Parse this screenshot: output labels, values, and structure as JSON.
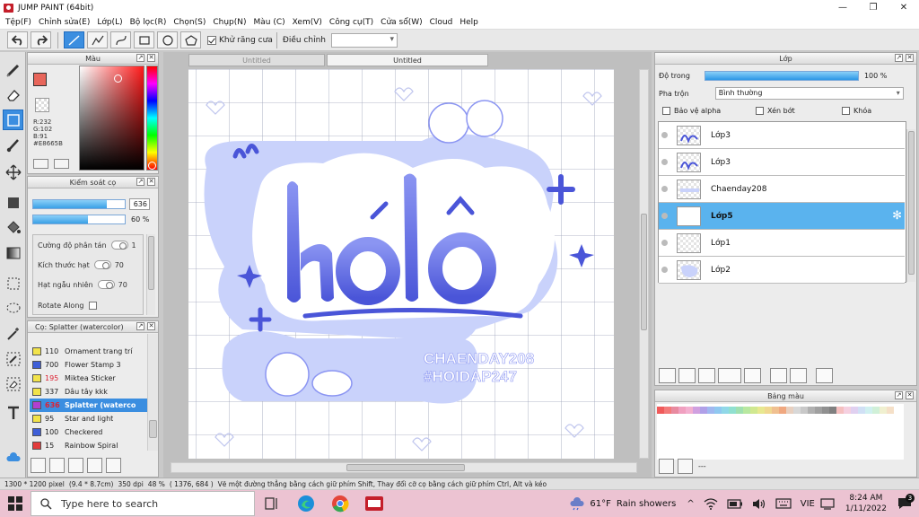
{
  "window": {
    "title": "JUMP PAINT (64bit)",
    "min": "—",
    "max": "❐",
    "close": "✕"
  },
  "menu": [
    "Tệp(F)",
    "Chỉnh sửa(E)",
    "Lớp(L)",
    "Bộ lọc(R)",
    "Chọn(S)",
    "Chụp(N)",
    "Màu (C)",
    "Xem(V)",
    "Công cụ(T)",
    "Cửa sổ(W)",
    "Cloud",
    "Help"
  ],
  "toolbar": {
    "antialias_label": "Khử răng cưa",
    "adjust_label": "Điều chỉnh",
    "adjust_value": ""
  },
  "color_panel": {
    "title": "Màu",
    "r": "R:232",
    "g": "G:102",
    "b": "B:91",
    "hex": "#E8665B",
    "fg_color": "#e8665b"
  },
  "brush_control": {
    "title": "Kiểm soát cọ",
    "size": "636",
    "size_fill": 0.8,
    "opacity": "60 %",
    "opacity_fill": 0.6,
    "scatter_label": "Cường độ phân tán",
    "scatter_value": "1",
    "grain_size_label": "Kích thước hạt",
    "grain_size_value": "70",
    "grain_random_label": "Hạt ngẫu nhiên",
    "grain_random_value": "70",
    "rotate_label": "Rotate Along"
  },
  "brush_list": {
    "title": "Cọ: Splatter (watercolor)",
    "items": [
      {
        "size": "110",
        "name": "Ornament trang trí",
        "color": "#f2e34a",
        "red": false
      },
      {
        "size": "700",
        "name": "Flower Stamp 3",
        "color": "#3f5fd8",
        "red": false
      },
      {
        "size": "195",
        "name": "Miktea Sticker",
        "color": "#f2e34a",
        "red": true
      },
      {
        "size": "337",
        "name": "Dâu tây kkk",
        "color": "#f2e34a",
        "red": false
      },
      {
        "size": "636",
        "name": "Splatter (waterco",
        "color": "#b23fd0",
        "red": true
      },
      {
        "size": "95",
        "name": "Star and light",
        "color": "#f2e34a",
        "red": false
      },
      {
        "size": "100",
        "name": "Checkered",
        "color": "#3f5fd8",
        "red": false
      },
      {
        "size": "15",
        "name": "Rainbow Spiral",
        "color": "#e23b3b",
        "red": false
      }
    ],
    "selected_index": 4
  },
  "tabs": [
    "Untitled",
    "Untitled"
  ],
  "artwork": {
    "title": "hélô",
    "line1": "CHAENDAY208",
    "line2": "#HOIDAP247"
  },
  "layer_panel": {
    "title": "Lớp",
    "opacity_label": "Độ trong",
    "opacity_value": "100 %",
    "opacity_fill": 1.0,
    "blend_label": "Pha trộn",
    "blend_value": "Bình thường",
    "protect_alpha": "Bảo vệ alpha",
    "clip": "Xén bớt",
    "lock": "Khóa",
    "layers": [
      {
        "name": "Lớp3"
      },
      {
        "name": "Lớp3"
      },
      {
        "name": "Chaenday208"
      },
      {
        "name": "Lớp5"
      },
      {
        "name": "Lớp1"
      },
      {
        "name": "Lớp2"
      }
    ],
    "selected_index": 3
  },
  "palette": {
    "title": "Bảng màu",
    "dash": "---",
    "colors": [
      "#f05a5a",
      "#f37a7a",
      "#e88aa0",
      "#f0a0c0",
      "#f3b0d0",
      "#d0a0e0",
      "#b0a0e8",
      "#a0b8f0",
      "#90c8f0",
      "#90d8e8",
      "#90e0d0",
      "#a0e0b0",
      "#b8e8a0",
      "#d0e890",
      "#e8e890",
      "#f0d890",
      "#f0c090",
      "#f0a880",
      "#e8d0c0",
      "#d8d8d8",
      "#c8c8c8",
      "#b0b0b0",
      "#a0a0a0",
      "#909090",
      "#808080",
      "#f5c0c0",
      "#f5d0e0",
      "#e0d0f0",
      "#d0e0f5",
      "#d0f0f0",
      "#d0f0d8",
      "#f0f0d0",
      "#f5e0c8",
      "#ffffff"
    ]
  },
  "status": {
    "size": "1300 * 1200 pixel",
    "cm": "(9.4 * 8.7cm)",
    "dpi": "350 dpi",
    "zoom": "48 %",
    "coords": "( 1376, 684 )",
    "hint": "Vẽ một đường thẳng bằng cách giữ phím Shift, Thay đổi cỡ cọ bằng cách giữ phím Ctrl, Alt và kéo"
  },
  "taskbar": {
    "search_placeholder": "Type here to search",
    "weather_temp": "61°F",
    "weather_text": "Rain showers",
    "lang": "VIE",
    "time": "8:24 AM",
    "date": "1/11/2022",
    "notify_count": "3"
  }
}
